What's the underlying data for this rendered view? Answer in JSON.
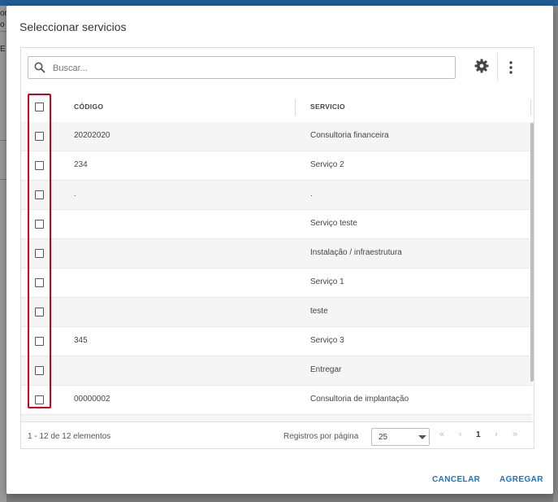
{
  "background": {
    "fragment_1": "or",
    "fragment_2": "o",
    "fragment_3": "E"
  },
  "dialog": {
    "title": "Seleccionar servicios"
  },
  "search": {
    "placeholder": "Buscar...",
    "value": ""
  },
  "toolbar": {
    "settings_icon": "gear-icon",
    "menu_icon": "more-vertical-icon"
  },
  "table": {
    "columns": [
      "CÓDIGO",
      "SERVICIO"
    ],
    "rows": [
      {
        "code": "20202020",
        "service": "Consultoria financeira",
        "selected": false
      },
      {
        "code": "234",
        "service": "Serviço 2",
        "selected": false
      },
      {
        "code": ".",
        "service": ".",
        "selected": false
      },
      {
        "code": "",
        "service": "Serviço teste",
        "selected": false
      },
      {
        "code": "",
        "service": "Instalação / infraestrutura",
        "selected": false
      },
      {
        "code": "",
        "service": "Serviço 1",
        "selected": false
      },
      {
        "code": "",
        "service": "teste",
        "selected": false
      },
      {
        "code": "345",
        "service": "Serviço 3",
        "selected": false
      },
      {
        "code": "",
        "service": "Entregar",
        "selected": false
      },
      {
        "code": "00000002",
        "service": "Consultoria de implantação",
        "selected": false
      }
    ]
  },
  "pagination": {
    "range_text": "1 - 12 de 12 elementos",
    "per_page_label": "Registros por página",
    "page_size": "25",
    "current_page": "1",
    "first": "«",
    "prev": "‹",
    "next": "›",
    "last": "»"
  },
  "actions": {
    "cancel_label": "CANCELAR",
    "add_label": "AGREGAR"
  },
  "colors": {
    "accent": "#1a73c8",
    "highlight": "#d0021b",
    "topbar": "#1f5d98"
  }
}
